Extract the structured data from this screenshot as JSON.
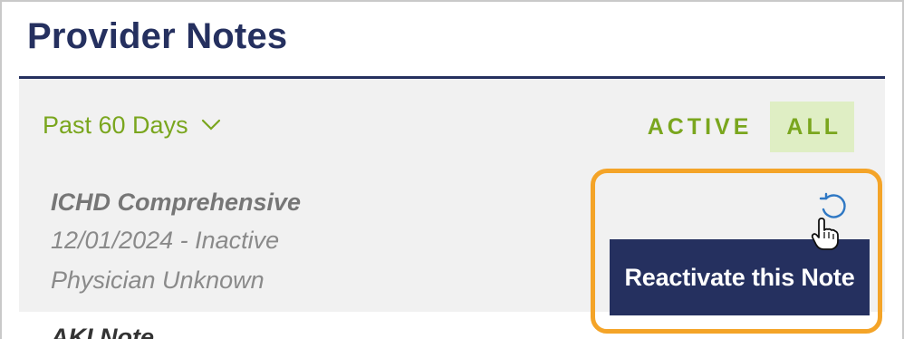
{
  "page": {
    "title": "Provider Notes"
  },
  "filter_bar": {
    "range_label": "Past 60 Days",
    "tabs": [
      {
        "label": "ACTIVE",
        "selected": false
      },
      {
        "label": "ALL",
        "selected": true
      }
    ]
  },
  "notes": [
    {
      "title": "ICHD Comprehensive",
      "date_status": "12/01/2024 - Inactive",
      "physician": "Physician Unknown"
    },
    {
      "title": "AKI Note"
    }
  ],
  "actions": {
    "reactivate_icon": "undo-icon",
    "tooltip": "Reactivate this Note"
  },
  "colors": {
    "navy": "#25305f",
    "green": "#7aa61e",
    "selected_bg": "#dfeec4",
    "highlight": "#f4a428",
    "icon_blue": "#2f78c4"
  }
}
